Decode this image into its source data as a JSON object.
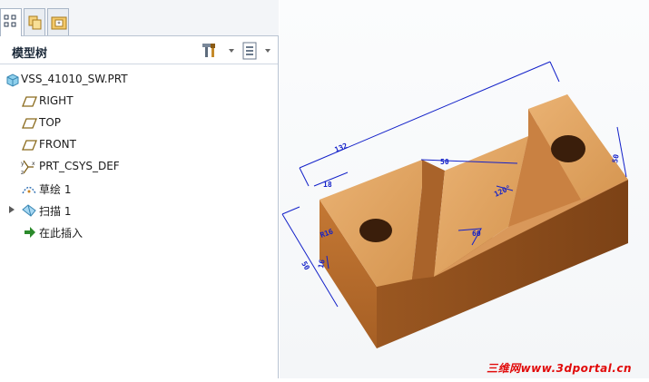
{
  "panel": {
    "title": "模型树",
    "tabs": [
      {
        "icon": "model-tree-tab-icon"
      },
      {
        "icon": "folder-browser-tab-icon"
      },
      {
        "icon": "favorites-tab-icon"
      }
    ],
    "header_buttons": [
      {
        "icon": "tree-settings-icon"
      },
      {
        "icon": "tree-filter-icon"
      }
    ]
  },
  "tree": {
    "items": [
      {
        "label": "VSS_41010_SW.PRT",
        "icon": "part-icon",
        "expandable": false
      },
      {
        "label": "RIGHT",
        "icon": "datum-plane-icon",
        "expandable": false
      },
      {
        "label": "TOP",
        "icon": "datum-plane-icon",
        "expandable": false
      },
      {
        "label": "FRONT",
        "icon": "datum-plane-icon",
        "expandable": false
      },
      {
        "label": "PRT_CSYS_DEF",
        "icon": "coordinate-system-icon",
        "expandable": false
      },
      {
        "label": "草绘 1",
        "icon": "sketch-icon",
        "expandable": false
      },
      {
        "label": "扫描 1",
        "icon": "sweep-icon",
        "expandable": true
      },
      {
        "label": "在此插入",
        "icon": "insert-here-arrow-icon",
        "expandable": false
      }
    ]
  },
  "model": {
    "dimensions": [
      "132",
      "18",
      "50",
      "50",
      "120°",
      "60",
      "50",
      "R16",
      "16"
    ],
    "colors": {
      "wood_top": "#e0a160",
      "wood_front": "#b76a2c",
      "wood_side": "#8e4f1e",
      "dimension": "#1321c9"
    }
  },
  "watermark": {
    "chinese": "三维网",
    "url": "www.3dportal.cn"
  }
}
